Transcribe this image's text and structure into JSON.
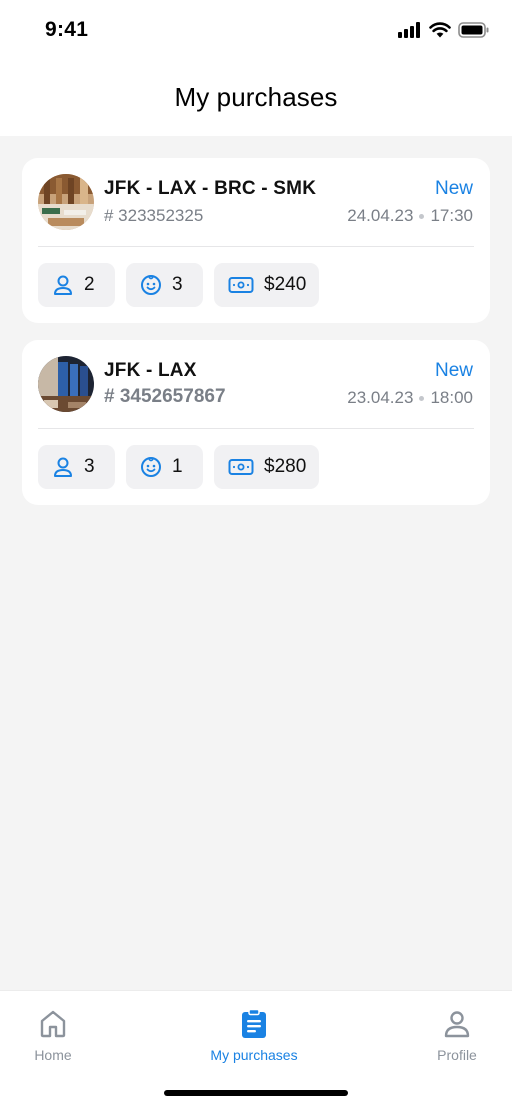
{
  "status_bar": {
    "time": "9:41"
  },
  "header": {
    "title": "My purchases"
  },
  "purchases": [
    {
      "route": "JFK - LAX - BRC - SMK",
      "order_number": "# 323352325",
      "status": "New",
      "date": "24.04.23",
      "time": "17:30",
      "adults": "2",
      "children": "3",
      "price": "$240"
    },
    {
      "route": "JFK - LAX",
      "order_number": "# 3452657867",
      "status": "New",
      "date": "23.04.23",
      "time": "18:00",
      "adults": "3",
      "children": "1",
      "price": "$280"
    }
  ],
  "tabbar": {
    "home": "Home",
    "purchases": "My purchases",
    "profile": "Profile"
  },
  "colors": {
    "accent": "#1a82e3",
    "muted": "#7a7f87",
    "background": "#f4f4f4"
  }
}
